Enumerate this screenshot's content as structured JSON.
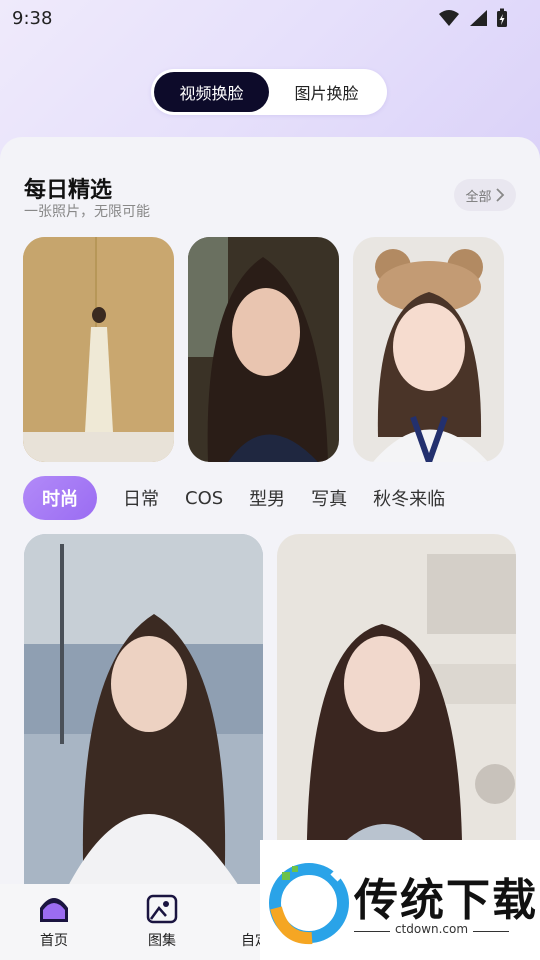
{
  "status_bar": {
    "time": "9:38"
  },
  "segment": {
    "active": "视频换脸",
    "inactive": "图片换脸"
  },
  "section": {
    "title": "每日精选",
    "subtitle": "一张照片，无限可能",
    "all_label": "全部"
  },
  "categories": [
    "时尚",
    "日常",
    "COS",
    "型男",
    "写真",
    "秋冬来临"
  ],
  "bottom_nav": {
    "home": "首页",
    "gallery": "图集",
    "custom": "自定"
  },
  "watermark": {
    "brand": "传统下载",
    "url": "ctdown.com"
  },
  "colors": {
    "accent": "#9a6cf2",
    "dark": "#0d0b2a"
  }
}
